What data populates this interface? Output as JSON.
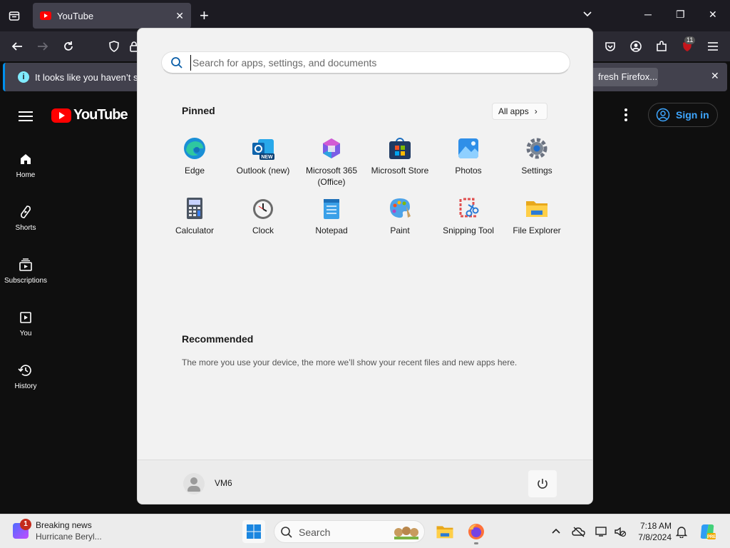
{
  "browser": {
    "tab_title": "YouTube",
    "notification_text": "It looks like you haven’t star",
    "notification_action": "fresh Firefox...",
    "extension_badge": "11"
  },
  "youtube": {
    "logo_text": "YouTube",
    "sign_in": "Sign in",
    "sidebar": [
      {
        "label": "Home",
        "icon": "home-icon"
      },
      {
        "label": "Shorts",
        "icon": "shorts-icon"
      },
      {
        "label": "Subscriptions",
        "icon": "subscriptions-icon"
      },
      {
        "label": "You",
        "icon": "you-icon"
      },
      {
        "label": "History",
        "icon": "history-icon"
      }
    ]
  },
  "start_menu": {
    "search_placeholder": "Search for apps, settings, and documents",
    "pinned_title": "Pinned",
    "all_apps": "All apps",
    "pinned": [
      {
        "name": "Edge",
        "icon": "edge-icon"
      },
      {
        "name": "Outlook (new)",
        "icon": "outlook-icon"
      },
      {
        "name": "Microsoft 365 (Office)",
        "icon": "m365-icon"
      },
      {
        "name": "Microsoft Store",
        "icon": "store-icon"
      },
      {
        "name": "Photos",
        "icon": "photos-icon"
      },
      {
        "name": "Settings",
        "icon": "settings-icon"
      },
      {
        "name": "Calculator",
        "icon": "calculator-icon"
      },
      {
        "name": "Clock",
        "icon": "clock-icon"
      },
      {
        "name": "Notepad",
        "icon": "notepad-icon"
      },
      {
        "name": "Paint",
        "icon": "paint-icon"
      },
      {
        "name": "Snipping Tool",
        "icon": "snipping-tool-icon"
      },
      {
        "name": "File Explorer",
        "icon": "file-explorer-icon"
      }
    ],
    "recommended_title": "Recommended",
    "recommended_text": "The more you use your device, the more we’ll show your recent files and new apps here.",
    "user_name": "VM6"
  },
  "taskbar": {
    "news_title": "Breaking news",
    "news_subtitle": "Hurricane Beryl...",
    "news_badge": "1",
    "search_label": "Search",
    "time": "7:18 AM",
    "date": "7/8/2024"
  }
}
